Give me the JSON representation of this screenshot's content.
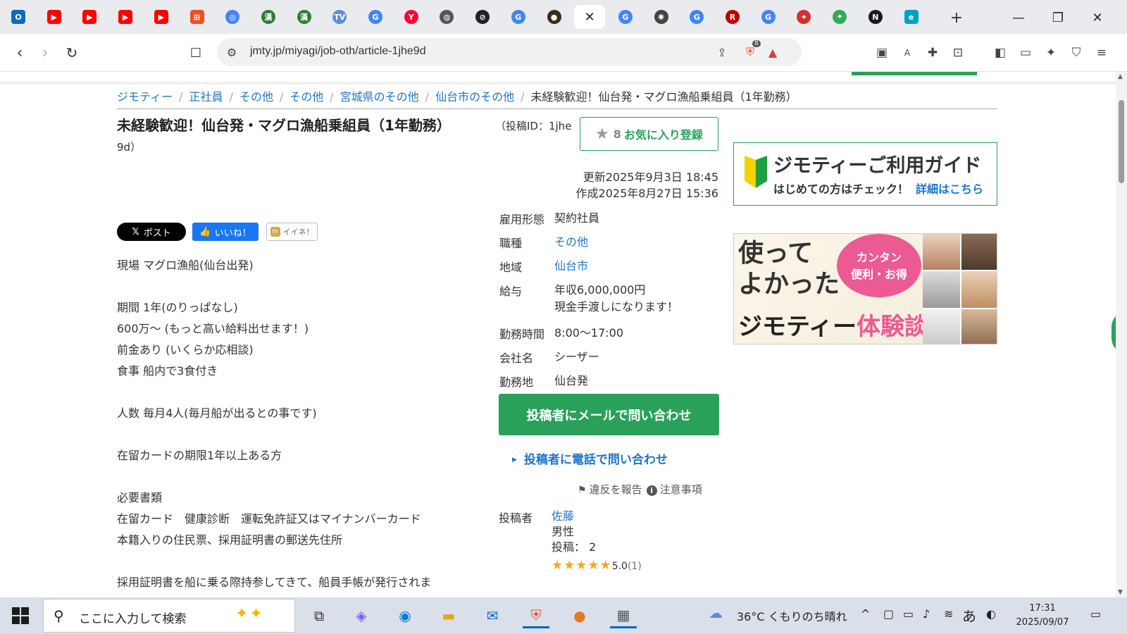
{
  "browser": {
    "url": "jmty.jp/miyagi/job-oth/article-1jhe9d",
    "shield_count": "8",
    "tabs": [
      {
        "icon": "outlook-icon",
        "color": "#0f6cbd"
      },
      {
        "icon": "youtube-icon",
        "color": "#ff0000"
      },
      {
        "icon": "youtube-icon",
        "color": "#ff0000"
      },
      {
        "icon": "youtube-icon",
        "color": "#ff0000"
      },
      {
        "icon": "youtube-icon",
        "color": "#ff0000"
      },
      {
        "icon": "microsoft-icon",
        "color": "#f25022"
      },
      {
        "icon": "chrome-icon",
        "color": "#4285f4"
      },
      {
        "icon": "kanji-icon",
        "color": "#2e7d32"
      },
      {
        "icon": "kanji-icon",
        "color": "#2e7d32"
      },
      {
        "icon": "tv-icon",
        "color": "#5b8fd6"
      },
      {
        "icon": "google-icon",
        "color": "#4285f4"
      },
      {
        "icon": "yahoo-icon",
        "color": "#ff0033"
      },
      {
        "icon": "globe-icon",
        "color": "#555555"
      },
      {
        "icon": "blocked-icon",
        "color": "#222222"
      },
      {
        "icon": "google-icon",
        "color": "#4285f4"
      },
      {
        "icon": "bear-icon",
        "color": "#3b2a1a"
      },
      {
        "icon": "close-icon",
        "color": "#222222"
      },
      {
        "icon": "google-icon",
        "color": "#4285f4"
      },
      {
        "icon": "openai-icon",
        "color": "#444444"
      },
      {
        "icon": "google-icon",
        "color": "#4285f4"
      },
      {
        "icon": "rakuten-icon",
        "color": "#bf0000"
      },
      {
        "icon": "google-icon",
        "color": "#4285f4"
      },
      {
        "icon": "red-app-icon",
        "color": "#d32f2f"
      },
      {
        "icon": "maps-icon",
        "color": "#34a853"
      },
      {
        "icon": "n-icon",
        "color": "#1a1a1a"
      },
      {
        "icon": "cyan-app-icon",
        "color": "#00a3c4"
      }
    ]
  },
  "page": {
    "breadcrumb": [
      "ジモティー",
      "正社員",
      "その他",
      "その他",
      "宮城県のその他",
      "仙台市のその他"
    ],
    "breadcrumb_current": "未経験歓迎！仙台発・マグロ漁船乗組員（1年勤務）",
    "title": "未経験歓迎！仙台発・マグロ漁船乗組員（1年勤務）",
    "post_id_a": "（投稿ID：1jhe",
    "post_id_b": "9d）",
    "favorite": {
      "count": "8",
      "label": "お気に入り登録"
    },
    "updated": "更新2025年9月3日 18:45",
    "created": "作成2025年8月27日 15:36",
    "share": {
      "x": "ポスト",
      "fb": "いいね！",
      "mixi": "イイネ！"
    },
    "description": [
      "現場  マグロ漁船(仙台出発)",
      "",
      "期間  1年(のりっぱなし)",
      "600万〜 (もっと高い給料出せます！)",
      "前金あり (いくらか応相談)",
      "食事 船内で3食付き",
      "",
      "人数 毎月4人(毎月船が出るとの事です)",
      "",
      "在留カードの期限1年以上ある方",
      "",
      "必要書類",
      "在留カード　健康診断　運転免許証又はマイナンバーカード",
      "本籍入りの住民票、採用証明書の郵送先住所",
      "",
      "採用証明書を船に乗る際持参してきて、船員手帳が発行されま"
    ],
    "info": {
      "employment": {
        "label": "雇用形態",
        "value": "契約社員"
      },
      "job_type": {
        "label": "職種",
        "value": "その他"
      },
      "area": {
        "label": "地域",
        "value": "仙台市"
      },
      "salary": {
        "label": "給与",
        "value": "年収6,000,000円",
        "note": "現金手渡しになります！"
      },
      "hours": {
        "label": "勤務時間",
        "value": "8:00〜17:00"
      },
      "company": {
        "label": "会社名",
        "value": "シーザー"
      },
      "location": {
        "label": "勤務地",
        "value": "仙台発"
      }
    },
    "mail_button": "投稿者にメールで問い合わせ",
    "tel_link": "投稿者に電話で問い合わせ",
    "report": "違反を報告",
    "notice": "注意事項",
    "poster": {
      "label": "投稿者",
      "name": "佐藤",
      "gender": "男性",
      "posts": "投稿： 2",
      "rating": "5.0",
      "rating_count": "(1)"
    },
    "guide": {
      "title": "ジモティーご利用ガイド",
      "sub": "はじめての方はチェック！",
      "link": "詳細はこちら"
    },
    "banner": {
      "line1": "使って",
      "line2": "よかった",
      "bubble1": "カンタン",
      "bubble2": "便利・お得",
      "brand": "ジモティー",
      "tail": "体験談"
    }
  },
  "taskbar": {
    "search_placeholder": "ここに入力して検索",
    "weather": "36°C  くもりのち晴れ",
    "ime": "あ",
    "time": "17:31",
    "date": "2025/09/07"
  },
  "colors": {
    "accent_green": "#2aa15a",
    "link_blue": "#1f75c9"
  }
}
